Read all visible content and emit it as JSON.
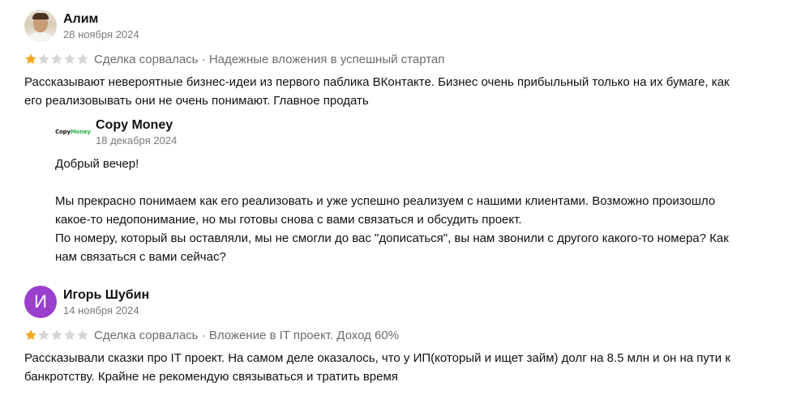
{
  "reviews": [
    {
      "author": "Алим",
      "date": "28 ноября 2024",
      "avatar": "photo",
      "rating": 1,
      "rating_max": 5,
      "tags": "Сделка сорвалась · Надежные вложения в успешный стартап",
      "text": "Рассказывают невероятные бизнес-идеи из первого паблика ВКонтакте. Бизнес очень прибыльный только на их бумаге, как\nего реализовывать они не очень понимают. Главное продать",
      "reply": {
        "author": "Copy Money",
        "logo_part1": "Copy",
        "logo_part2": "Money",
        "date": "18 декабря 2024",
        "text": "Добрый вечер!\n\nМы прекрасно понимаем как его реализовать и уже успешно реализуем с нашими клиентами. Возможно произошло\nкакое-то недопонимание, но мы готовы снова с вами связаться и обсудить проект.\nПо номеру, который вы оставляли, мы не смогли до вас \"дописаться\", вы нам звонили с другого какого-то номера? Как\nнам связаться с вами сейчас?"
      }
    },
    {
      "author": "Игорь Шубин",
      "date": "14 ноября 2024",
      "avatar_letter": "И",
      "avatar_color": "#9b3fcf",
      "rating": 1,
      "rating_max": 5,
      "tags": "Сделка сорвалась · Вложение в IT проект. Доход 60%",
      "text": "Рассказывали сказки про IT проект. На самом деле оказалось, что у ИП(который и ищет займ) долг на 8.5 млн и он на пути к\nбанкротству. Крайне не рекомендую связываться и тратить время"
    }
  ],
  "colors": {
    "star_filled": "#f5a623",
    "star_empty": "#d6d6d6"
  }
}
